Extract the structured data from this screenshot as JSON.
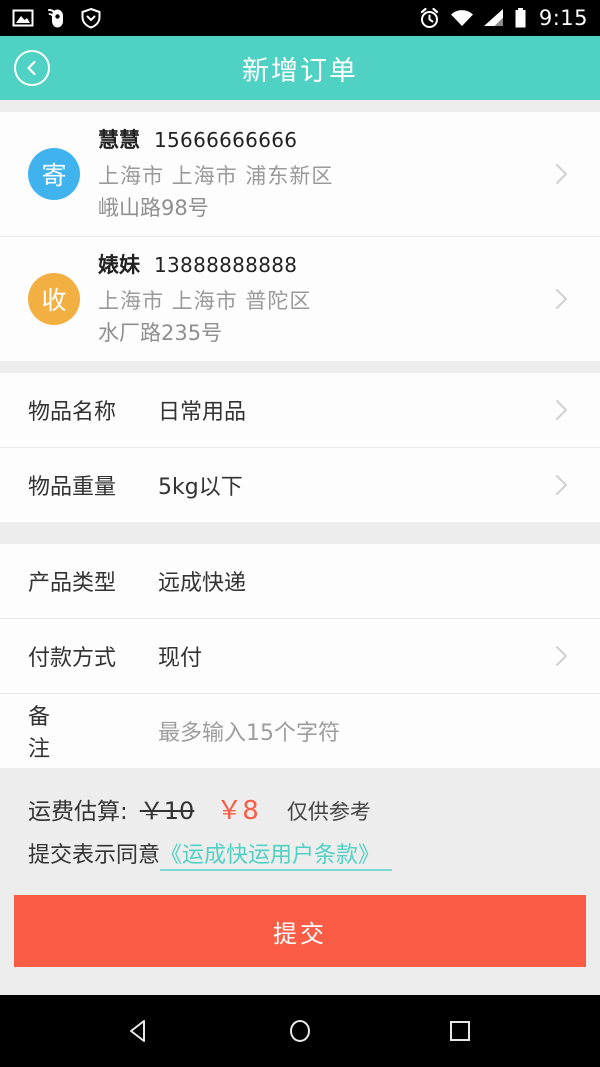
{
  "status_bar": {
    "time": "9:15",
    "left_icons": [
      "image-icon",
      "mouse-icon",
      "shield-icon"
    ],
    "right_icons": [
      "alarm-icon",
      "wifi-icon",
      "signal-icon",
      "battery-icon"
    ]
  },
  "app_bar": {
    "title": "新增订单",
    "back_label": "返回",
    "background": "#4fd1c3"
  },
  "addresses": [
    {
      "badge": "寄",
      "badge_color": "#40b3ef",
      "name": "慧慧",
      "phone": "15666666666",
      "region": "上海市  上海市  浦东新区",
      "street": "峨山路98号"
    },
    {
      "badge": "收",
      "badge_color": "#f2b042",
      "name": "婊妹",
      "phone": "13888888888",
      "region": "上海市  上海市  普陀区",
      "street": "水厂路235号"
    }
  ],
  "form_groups": [
    {
      "rows": [
        {
          "label": "物品名称",
          "value": "日常用品",
          "chevron": true,
          "placeholder": false
        },
        {
          "label": "物品重量",
          "value": "5kg以下",
          "chevron": true,
          "placeholder": false
        }
      ]
    },
    {
      "rows": [
        {
          "label": "产品类型",
          "value": "远成快递",
          "chevron": false,
          "placeholder": false
        },
        {
          "label": "付款方式",
          "value": "现付",
          "chevron": true,
          "placeholder": false
        },
        {
          "label": "备　注",
          "value": "最多输入15个字符",
          "chevron": false,
          "placeholder": true
        }
      ]
    }
  ],
  "fee": {
    "label": "运费估算:",
    "original_price": "￥10",
    "current_price": "￥8",
    "note": "仅供参考",
    "agree_prefix": "提交表示同意",
    "agree_link": "《运成快运用户条款》",
    "accent_color": "#fa5c45",
    "link_color": "#4fd1c3"
  },
  "submit": {
    "label": "提交",
    "color": "#fa5c45"
  },
  "nav_bar": {
    "buttons": [
      "back-triangle-icon",
      "home-circle-icon",
      "recents-square-icon"
    ]
  }
}
